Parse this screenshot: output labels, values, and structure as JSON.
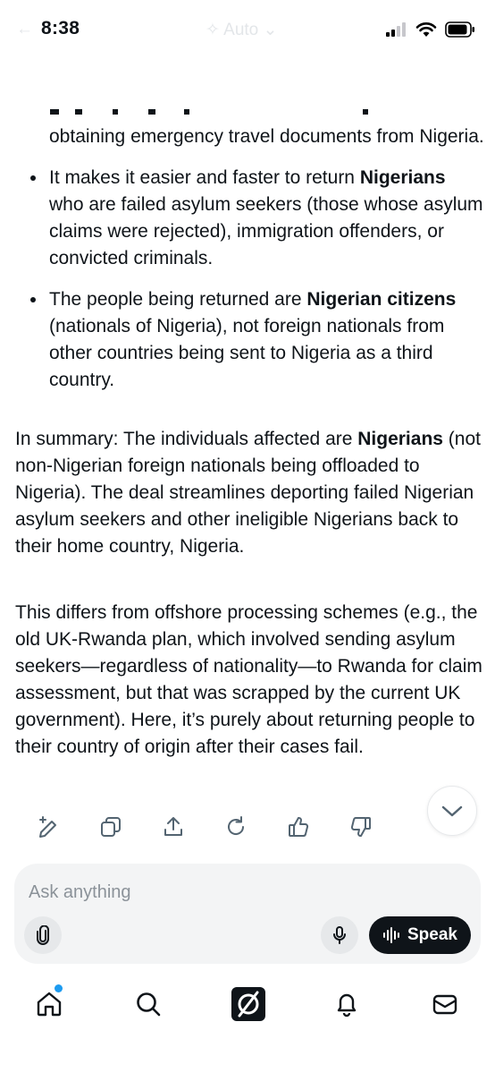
{
  "status_bar": {
    "time": "8:38",
    "ghost_back": "←",
    "ghost_mode": "Auto"
  },
  "response": {
    "bullets": [
      {
        "continued": true,
        "segments": [
          {
            "text": "obtaining emergency travel documents from Nigeria.",
            "bold": false
          }
        ]
      },
      {
        "continued": false,
        "segments": [
          {
            "text": "It makes it easier and faster to return ",
            "bold": false
          },
          {
            "text": "Nigerians",
            "bold": true
          },
          {
            "text": " who are failed asylum seekers (those whose asylum claims were rejected), immigration offenders, or convicted criminals.",
            "bold": false
          }
        ]
      },
      {
        "continued": false,
        "segments": [
          {
            "text": "The people being returned are ",
            "bold": false
          },
          {
            "text": "Nigerian citizens",
            "bold": true
          },
          {
            "text": " (nationals of Nigeria), not foreign nationals from other countries being sent to Nigeria as a third country.",
            "bold": false
          }
        ]
      }
    ],
    "summary": {
      "before": "In summary: The individuals affected are ",
      "bold": "Nigerians",
      "after": " (not non-Nigerian foreign nationals being offloaded to Nigeria). The deal streamlines deporting failed Nigerian asylum seekers and other ineligible Nigerians back to their home country, Nigeria."
    },
    "differs": "This differs from offshore processing schemes (e.g., the old UK-Rwanda plan, which involved sending asylum seekers—regardless of nationality—to Rwanda for claim assessment, but that was scrapped by the current UK government). Here, it’s purely about returning people to their country of origin after their cases fail."
  },
  "actions": {
    "icons": [
      "edit-sparkle-icon",
      "copy-icon",
      "share-icon",
      "regenerate-icon",
      "thumbs-up-icon",
      "thumbs-down-icon",
      "chevron-down-icon"
    ]
  },
  "composer": {
    "placeholder": "Ask anything",
    "speak_label": "Speak",
    "icons": [
      "paperclip-icon",
      "microphone-icon",
      "waveform-icon"
    ]
  },
  "tabbar": {
    "icons": [
      "home-icon",
      "search-icon",
      "grok-icon",
      "bell-icon",
      "mail-icon"
    ],
    "home_has_dot": true
  },
  "colors": {
    "text": "#0f1419",
    "accent": "#1d9bf0",
    "composer_bg": "#f3f4f5",
    "speak_bg": "#0f1419"
  }
}
